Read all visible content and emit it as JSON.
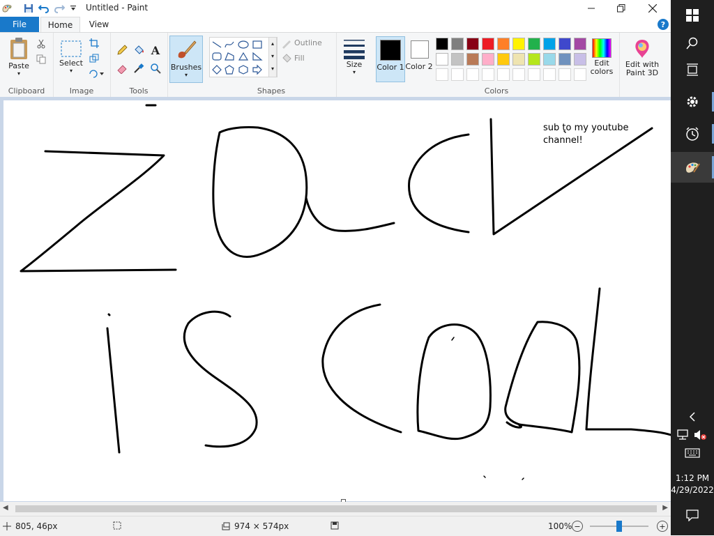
{
  "window": {
    "title": "Untitled - Paint",
    "controls": {
      "minimize": "—",
      "maximize": "□",
      "close": "✕"
    }
  },
  "tabs": {
    "file": "File",
    "home": "Home",
    "view": "View",
    "help": "?"
  },
  "ribbon": {
    "clipboard": {
      "label": "Clipboard",
      "paste": "Paste"
    },
    "image": {
      "label": "Image",
      "select": "Select"
    },
    "tools": {
      "label": "Tools"
    },
    "brushes": {
      "label": "Brushes"
    },
    "shapes": {
      "label": "Shapes",
      "outline": "Outline",
      "fill": "Fill"
    },
    "size": {
      "label": "Size"
    },
    "colors": {
      "label": "Colors",
      "color1": "Color 1",
      "color2": "Color 2",
      "edit": "Edit colors",
      "paint3d": "Edit with Paint 3D",
      "color1_value": "#000000",
      "color2_value": "#ffffff",
      "palette_row1": [
        "#000000",
        "#7f7f7f",
        "#880015",
        "#ed1c24",
        "#ff7f27",
        "#fff200",
        "#22b14c",
        "#00a2e8",
        "#3f48cc",
        "#a349a4"
      ],
      "palette_row2": [
        "#ffffff",
        "#c3c3c3",
        "#b97a57",
        "#ffaec9",
        "#ffc90e",
        "#efe4b0",
        "#b5e61d",
        "#99d9ea",
        "#7092be",
        "#c8bfe7"
      ]
    }
  },
  "canvas": {
    "text_note_line1": "sub to my youtube",
    "text_note_line2": "channel!"
  },
  "status": {
    "cursor_pos": "805, 46px",
    "canvas_size": "974 × 574px",
    "zoom": "100%"
  },
  "taskbar": {
    "time": "1:12 PM",
    "date": "4/29/2022"
  }
}
